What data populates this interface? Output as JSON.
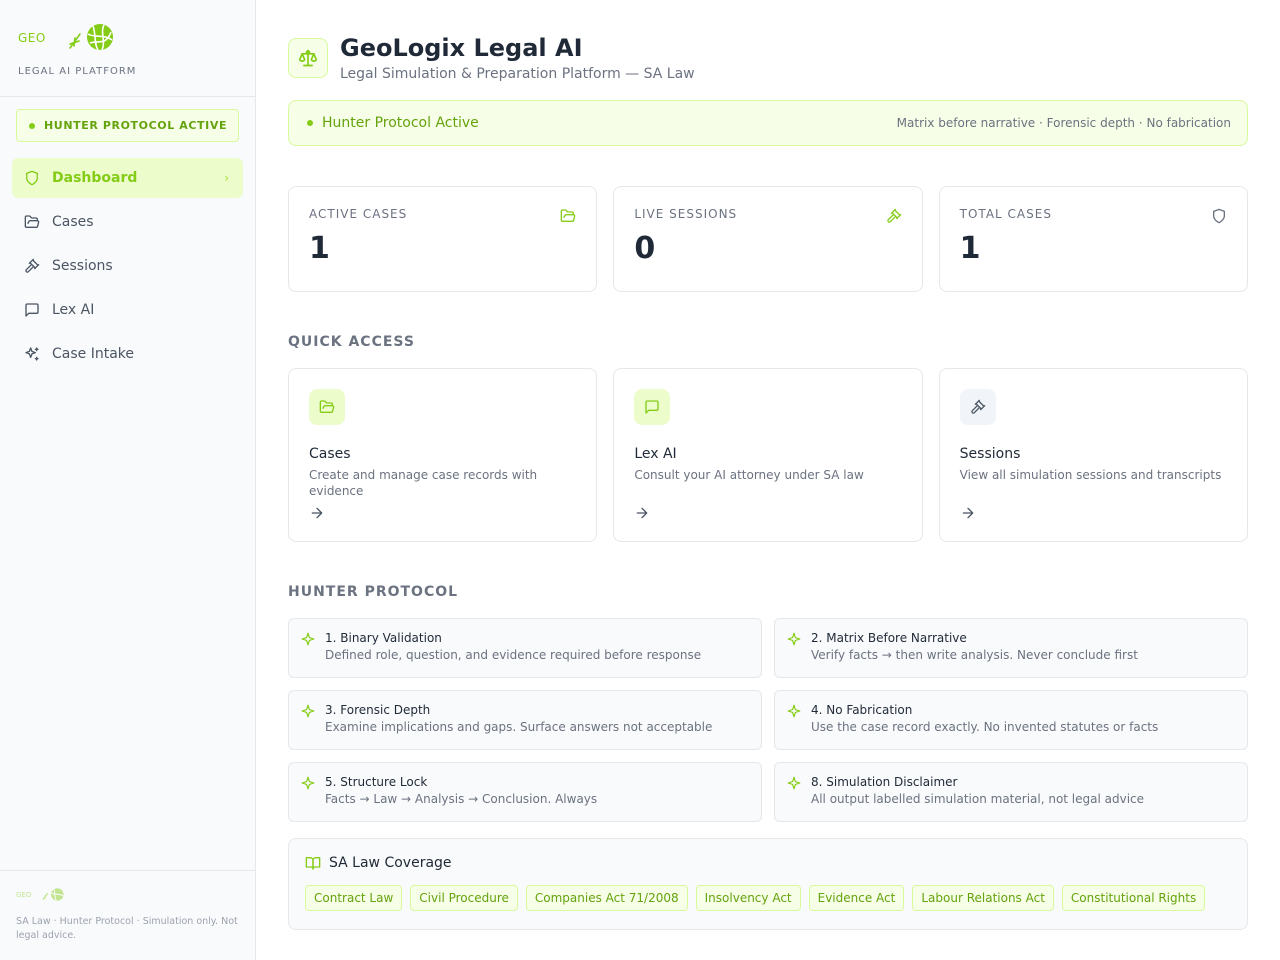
{
  "sidebar": {
    "brand_short": "GEO",
    "brand_sub": "LEGAL AI PLATFORM",
    "protocol_pill": "HUNTER PROTOCOL ACTIVE",
    "nav": [
      {
        "label": "Dashboard",
        "icon": "shield-icon",
        "active": true
      },
      {
        "label": "Cases",
        "icon": "folder-open-icon"
      },
      {
        "label": "Sessions",
        "icon": "gavel-icon"
      },
      {
        "label": "Lex AI",
        "icon": "message-square-icon"
      },
      {
        "label": "Case Intake",
        "icon": "sparkles-icon"
      }
    ],
    "footer_text": "SA Law · Hunter Protocol · Simulation only. Not legal advice."
  },
  "header": {
    "title": "GeoLogix Legal AI",
    "subtitle": "Legal Simulation & Preparation Platform — SA Law",
    "icon": "scale-icon"
  },
  "banner": {
    "label": "Hunter Protocol Active",
    "right": "Matrix before narrative · Forensic depth · No fabrication"
  },
  "stats": [
    {
      "label": "ACTIVE CASES",
      "value": "1",
      "icon": "folder-open-icon"
    },
    {
      "label": "LIVE SESSIONS",
      "value": "0",
      "icon": "gavel-icon"
    },
    {
      "label": "TOTAL CASES",
      "value": "1",
      "icon": "shield-icon"
    }
  ],
  "quick_access": {
    "title": "QUICK ACCESS",
    "cards": [
      {
        "title": "Cases",
        "desc": "Create and manage case records with evidence",
        "icon": "folder-open-icon"
      },
      {
        "title": "Lex AI",
        "desc": "Consult your AI attorney under SA law",
        "icon": "message-square-icon"
      },
      {
        "title": "Sessions",
        "desc": "View all simulation sessions and transcripts",
        "icon": "gavel-icon"
      }
    ]
  },
  "hunter_protocol": {
    "title": "HUNTER PROTOCOL",
    "items": [
      {
        "title": "1. Binary Validation",
        "desc": "Defined role, question, and evidence required before response"
      },
      {
        "title": "2. Matrix Before Narrative",
        "desc": "Verify facts → then write analysis. Never conclude first"
      },
      {
        "title": "3. Forensic Depth",
        "desc": "Examine implications and gaps. Surface answers not acceptable"
      },
      {
        "title": "4. No Fabrication",
        "desc": "Use the case record exactly. No invented statutes or facts"
      },
      {
        "title": "5. Structure Lock",
        "desc": "Facts → Law → Analysis → Conclusion. Always"
      },
      {
        "title": "8. Simulation Disclaimer",
        "desc": "All output labelled simulation material, not legal advice"
      }
    ]
  },
  "coverage": {
    "title": "SA Law Coverage",
    "tags": [
      "Contract Law",
      "Civil Procedure",
      "Companies Act 71/2008",
      "Insolvency Act",
      "Evidence Act",
      "Labour Relations Act",
      "Constitutional Rights"
    ]
  },
  "colors": {
    "accent": "#84cc16",
    "accent_dark": "#65a30d",
    "accent_bg": "#f7fee7",
    "border": "#e5e7eb"
  }
}
